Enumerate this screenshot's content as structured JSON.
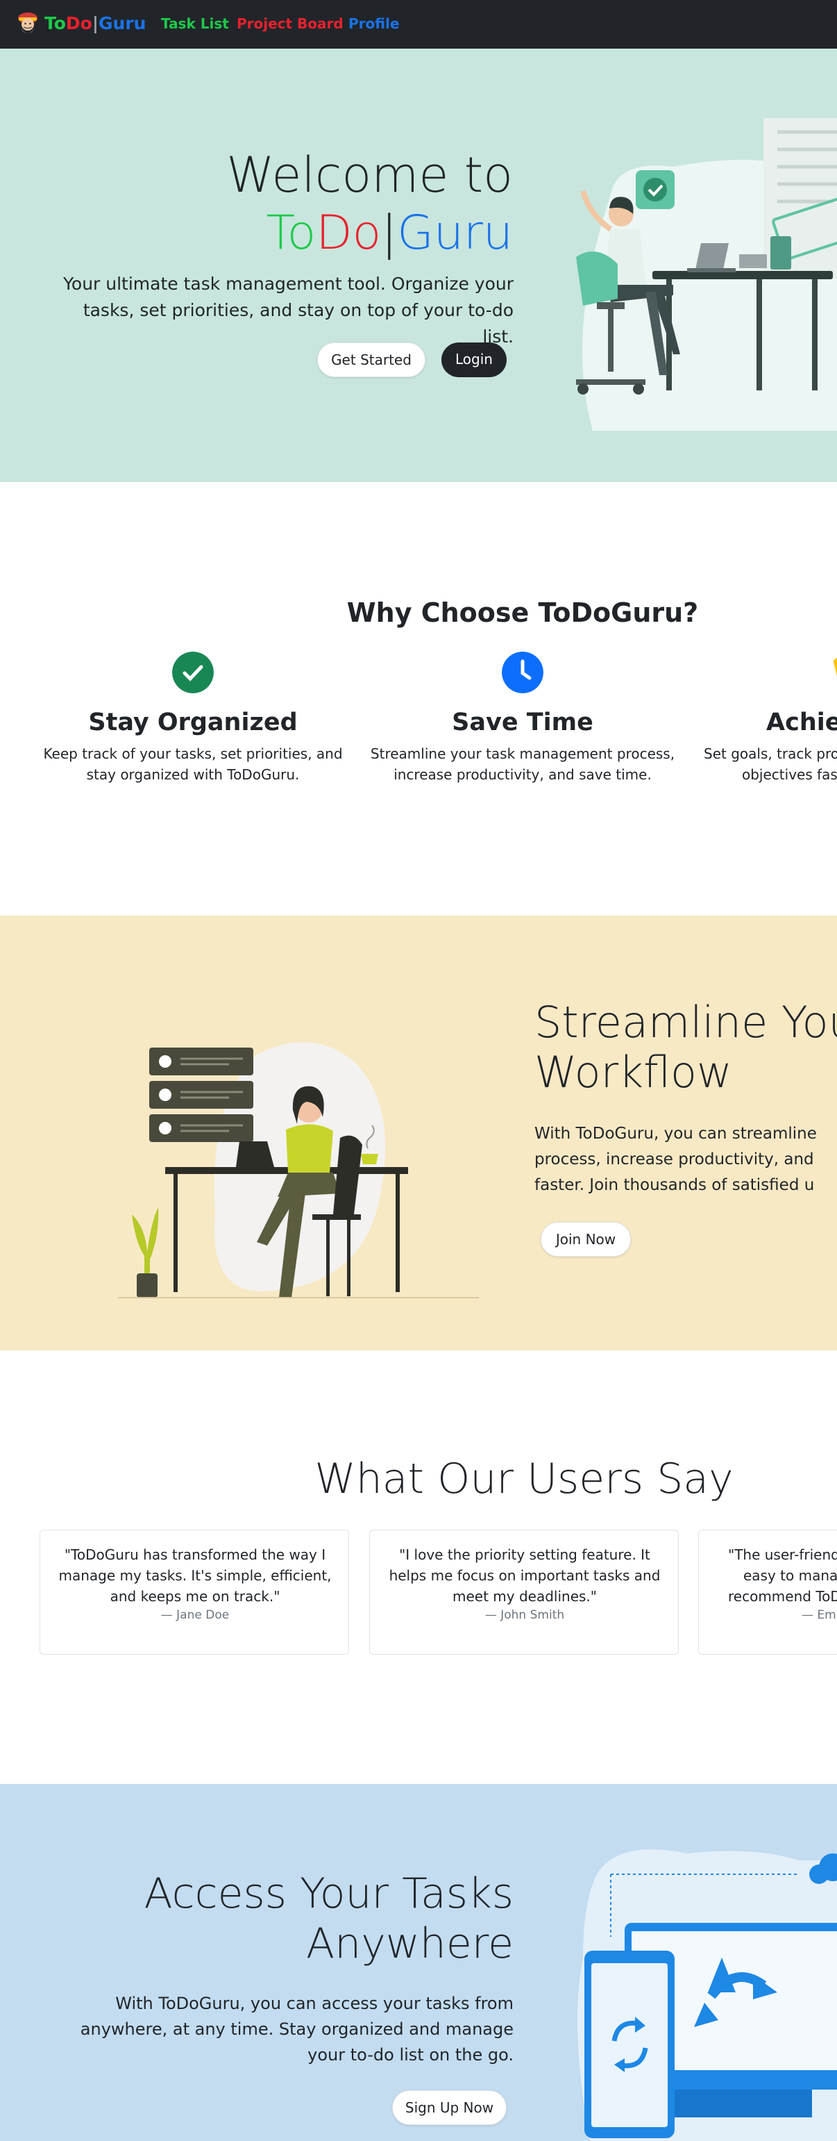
{
  "nav": {
    "brand": {
      "part1": "To",
      "part2": "Do",
      "sep": "|",
      "part3": "Guru"
    },
    "links": [
      "Task List",
      "Project Board",
      "Profile"
    ],
    "link_colors": [
      "#1fc94a",
      "#e8212e",
      "#1a73e8"
    ]
  },
  "hero": {
    "title_line1": "Welcome to",
    "title_brand": {
      "part1": "To",
      "part2": "Do",
      "sep": "|",
      "part3": "Guru"
    },
    "subtitle": "Your ultimate task management tool. Organize your tasks, set priorities, and stay on top of your to-do list.",
    "get_started_label": "Get Started",
    "login_label": "Login"
  },
  "why": {
    "heading": "Why Choose ToDoGuru?",
    "features": [
      {
        "title": "Stay Organized",
        "desc": "Keep track of your tasks, set priorities, and stay organized with ToDoGuru.",
        "icon": "check-circle-icon",
        "color": "#198754"
      },
      {
        "title": "Save Time",
        "desc": "Streamline your task management process, increase productivity, and save time.",
        "icon": "clock-icon",
        "color": "#0d6efd"
      },
      {
        "title": "Achie",
        "desc_line1": "Set goals, track pro",
        "desc_line2": "objectives fas",
        "icon": "trophy-icon",
        "color": "#ffc107"
      }
    ]
  },
  "streamline": {
    "heading_line1": "Streamline You",
    "heading_line2": "Workflow",
    "para_lines": [
      "With ToDoGuru, you can streamline",
      "process, increase productivity, and",
      "faster. Join thousands of satisfied u"
    ],
    "join_label": "Join Now"
  },
  "users": {
    "heading": "What Our Users Say",
    "testimonials": [
      {
        "quote": "\"ToDoGuru has transformed the way I manage my tasks. It's simple, efficient, and keeps me on track.\"",
        "name": "— Jane Doe"
      },
      {
        "quote": "\"I love the priority setting feature. It helps me focus on important tasks and meet my deadlines.\"",
        "name": "— John Smith"
      },
      {
        "quote_lines": [
          "\"The user-friend",
          "easy to manag",
          "recommend ToD"
        ],
        "name": "— Em"
      }
    ]
  },
  "access": {
    "heading_line1": "Access Your Tasks",
    "heading_line2": "Anywhere",
    "para": "With ToDoGuru, you can access your tasks from anywhere, at any time. Stay organized and manage your to-do list on the go.",
    "signup_label": "Sign Up Now"
  }
}
